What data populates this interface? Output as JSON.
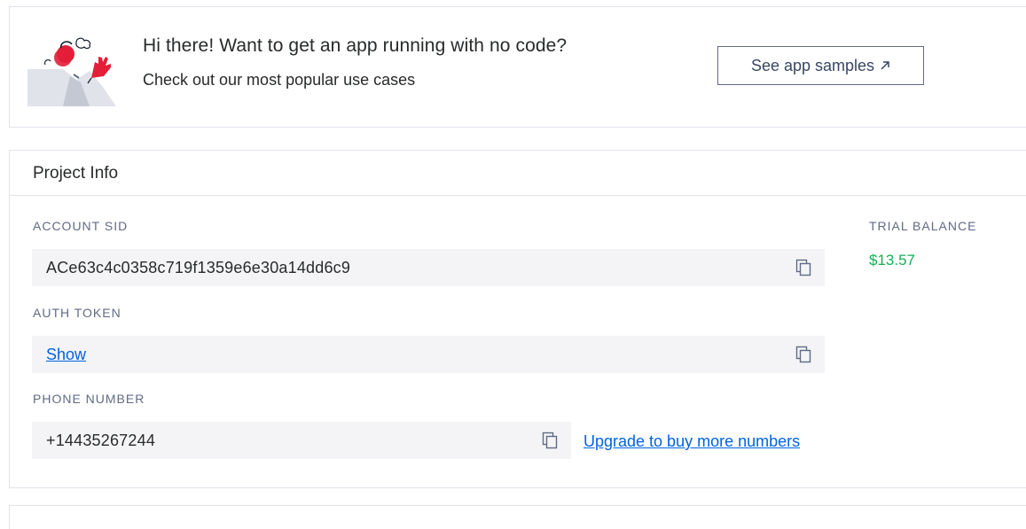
{
  "banner": {
    "title": "Hi there! Want to get an app running with no code?",
    "subtitle": "Check out our most popular use cases",
    "samples_button": "See app samples",
    "illustration_icon": "waving-character-illustration",
    "arrow_icon": "external-arrow-icon"
  },
  "project": {
    "title": "Project Info",
    "account_sid_label": "ACCOUNT SID",
    "account_sid_value": "ACe63c4c0358c719f1359e6e30a14dd6c9",
    "auth_token_label": "AUTH TOKEN",
    "auth_token_link": "Show",
    "phone_label": "PHONE NUMBER",
    "phone_value": "+14435267244",
    "upgrade_link": "Upgrade to buy more numbers",
    "trial_balance_label": "TRIAL BALANCE",
    "trial_balance_value": "$13.57",
    "copy_icon": "copy-icon"
  },
  "colors": {
    "link": "#0263e0",
    "balance": "#14b053",
    "field_bg": "#f4f4f6",
    "border": "#e1e3ea",
    "accent_red": "#e31e38"
  }
}
